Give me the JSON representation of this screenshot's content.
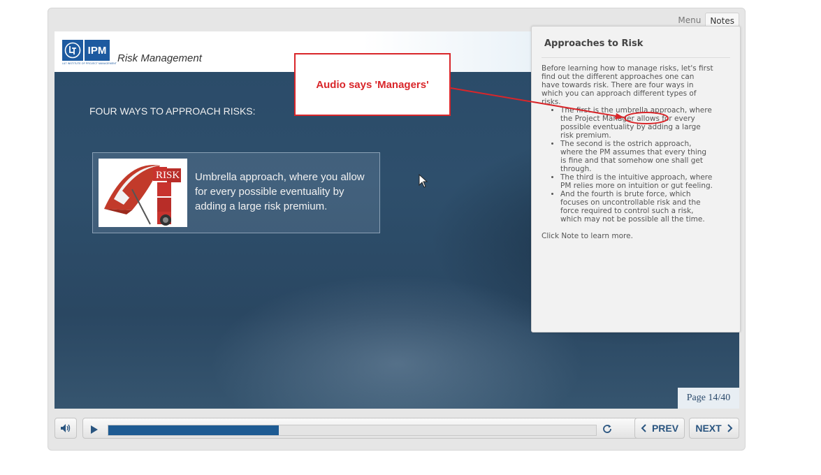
{
  "tabs": [
    {
      "label": "Menu",
      "active": false
    },
    {
      "label": "Notes",
      "active": true
    }
  ],
  "header": {
    "logo_text": "IPM",
    "logo_subtext": "L&T INSTITUTE OF PROJECT MANAGEMENT",
    "course_title": "Risk Management"
  },
  "slide": {
    "heading": "FOUR WAYS TO APPROACH RISKS:",
    "card_text": "Umbrella approach, where you allow for every possible eventuality by adding a large risk premium.",
    "image_letters": "RISK",
    "page_label": "Page 14/40"
  },
  "notes": {
    "title": "Approaches to Risk",
    "intro": "Before learning how to manage risks, let's first find out the different approaches one can have towards risk. There are four ways in which you can approach different types of risks.",
    "bullets": [
      "The first is the umbrella approach, where the Project Manager allows for every possible eventuality by adding a large risk premium.",
      "The second is the ostrich approach, where the PM assumes that every thing is fine and that somehow one shall get through.",
      "The third is the intuitive approach, where PM relies more on intuition or gut feeling.",
      "And the fourth is brute force, which focuses on uncontrollable risk and the force required to control such a risk, which may not be possible all the time."
    ],
    "footer": "Click Note to learn more."
  },
  "annotation": {
    "callout_text": "Audio says 'Managers'",
    "color": "#d9262a"
  },
  "controls": {
    "prev_label": "PREV",
    "next_label": "NEXT",
    "progress_fraction": 0.35
  },
  "colors": {
    "brand_blue": "#1d5aa0",
    "progress_fill": "#1e5b93",
    "stage_bg": "#2c4c6a"
  },
  "icons": {
    "volume": "volume-icon",
    "play": "play-icon",
    "replay": "replay-icon",
    "prev": "chevron-left-icon",
    "next": "chevron-right-icon",
    "cursor": "mouse-cursor-icon"
  }
}
